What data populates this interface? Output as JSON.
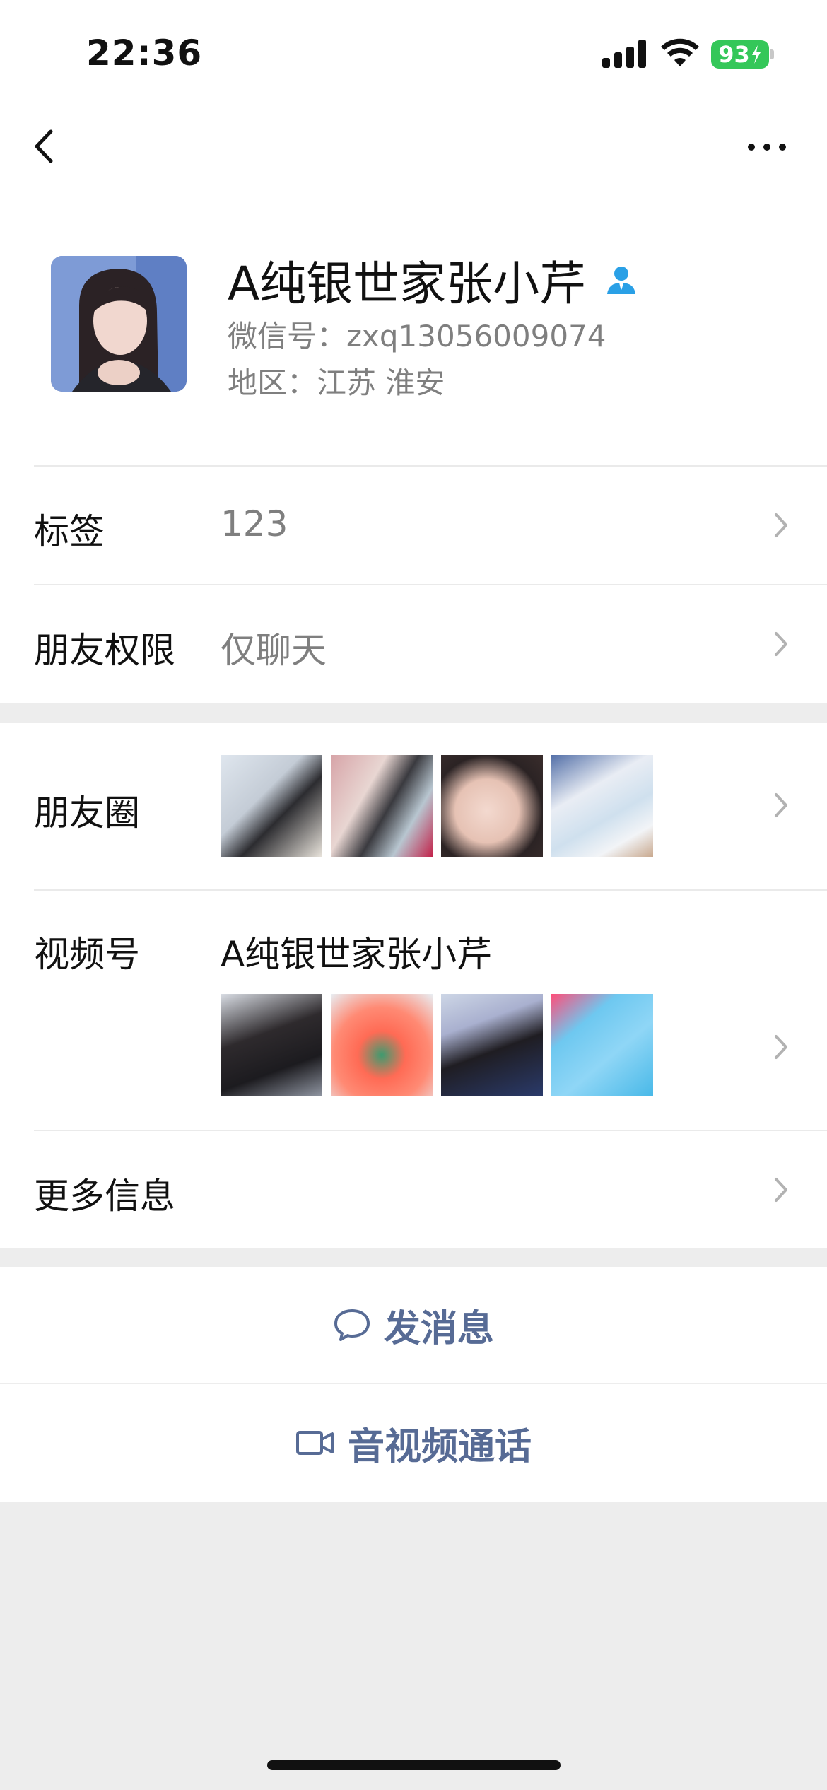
{
  "status_bar": {
    "time": "22:36",
    "battery": "93"
  },
  "profile": {
    "name": "A纯银世家张小芹",
    "wechat_id": "微信号：zxq13056009074",
    "region": "地区：江苏 淮安"
  },
  "rows": {
    "tags": {
      "label": "标签",
      "value": "123"
    },
    "permission": {
      "label": "朋友权限",
      "value": "仅聊天"
    },
    "moments": {
      "label": "朋友圈"
    },
    "channels": {
      "label": "视频号",
      "value": "A纯银世家张小芹"
    },
    "more_info": {
      "label": "更多信息"
    }
  },
  "actions": {
    "message": "发消息",
    "call": "音视频通话"
  },
  "colors": {
    "link_blue": "#576b95",
    "verify_blue": "#2aa0e6",
    "battery_green": "#34c759",
    "bg_gray": "#ededed"
  },
  "icons": [
    "back-icon",
    "more-icon",
    "verified-user-icon",
    "chevron-right-icon",
    "chat-bubble-icon",
    "video-camera-icon"
  ]
}
